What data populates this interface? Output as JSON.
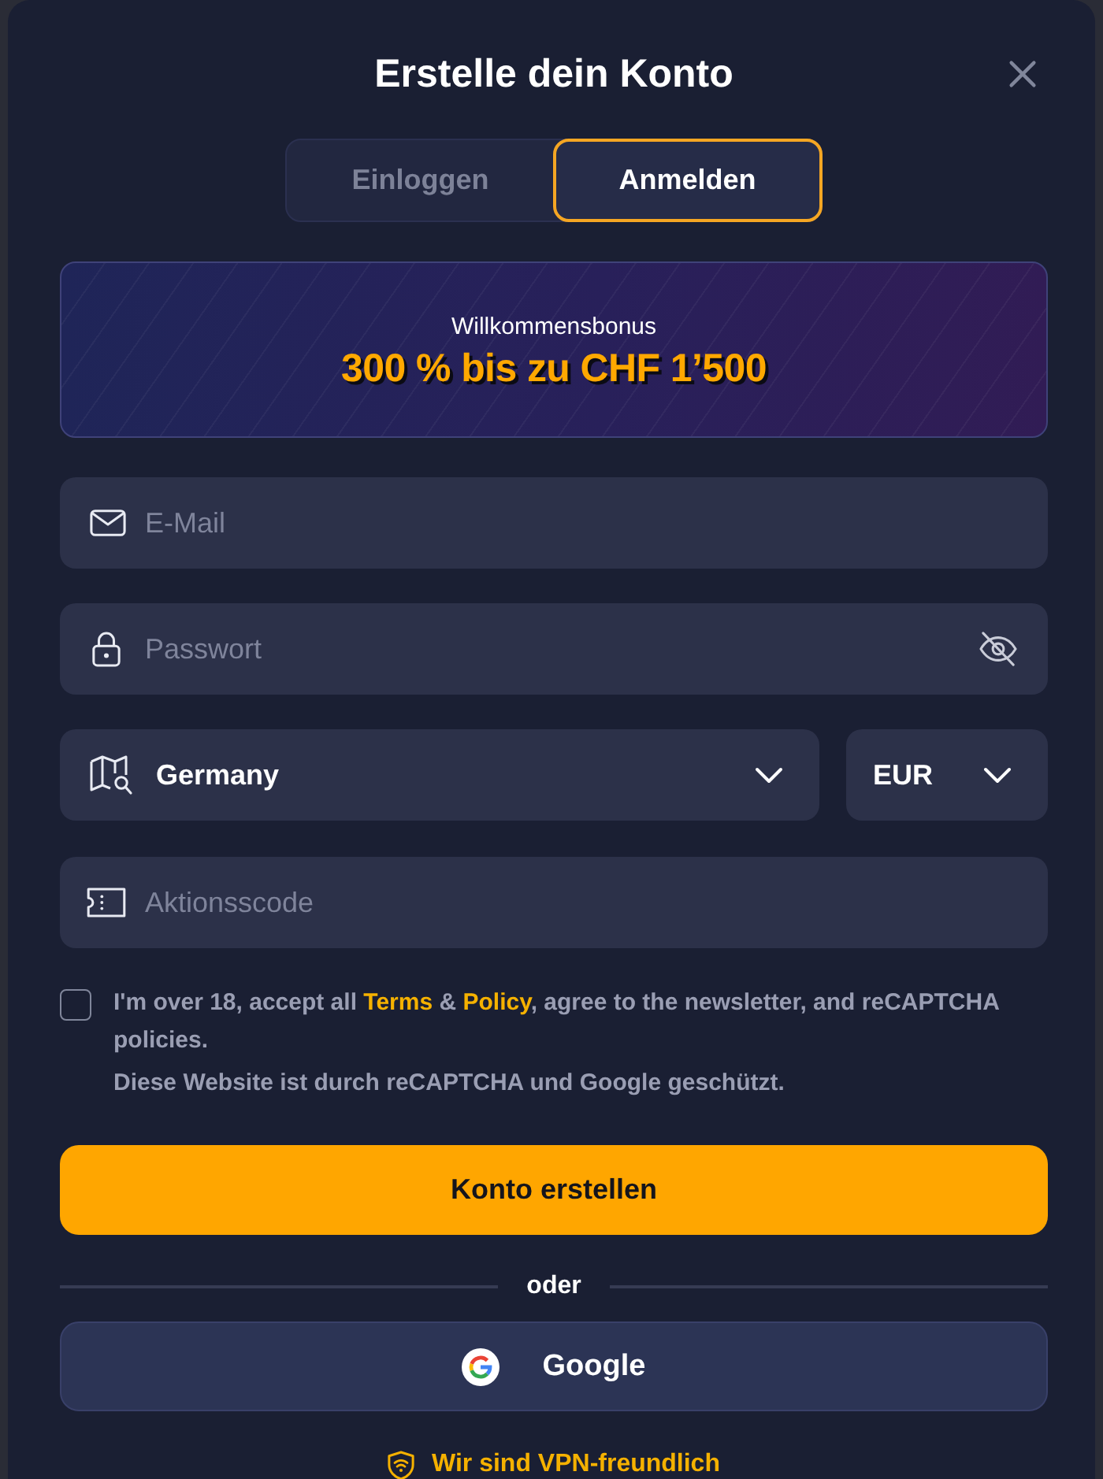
{
  "dialog": {
    "title": "Erstelle dein Konto"
  },
  "tabs": [
    {
      "label": "Einloggen",
      "selected": false
    },
    {
      "label": "Anmelden",
      "selected": true
    }
  ],
  "bonus_banner": {
    "caption": "Willkommensbonus",
    "headline": "300 % bis zu CHF 1’500"
  },
  "fields": [
    {
      "kind": "email",
      "placeholder": "E-Mail"
    },
    {
      "kind": "password",
      "placeholder": "Passwort"
    }
  ],
  "country_select": {
    "value": "Germany"
  },
  "currency_select": {
    "value": "EUR"
  },
  "promo_field": {
    "placeholder": "Aktionsscode"
  },
  "consent": {
    "checked": false,
    "parts": [
      {
        "kind": "text",
        "text": "I'm over 18, accept all "
      },
      {
        "kind": "link",
        "text": "Terms"
      },
      {
        "kind": "text",
        "text": " & "
      },
      {
        "kind": "link",
        "text": "Policy"
      },
      {
        "kind": "text",
        "text": ", agree to the newsletter, and reCAPTCHA policies."
      }
    ],
    "note": "Diese Website ist durch reCAPTCHA und Google geschützt."
  },
  "submit_button": {
    "label": "Konto erstellen"
  },
  "divider": {
    "label": "oder"
  },
  "social_buttons": [
    {
      "kind": "google",
      "label": "Google"
    }
  ],
  "vpn_note": {
    "text": "Wir sind VPN-freundlich"
  }
}
